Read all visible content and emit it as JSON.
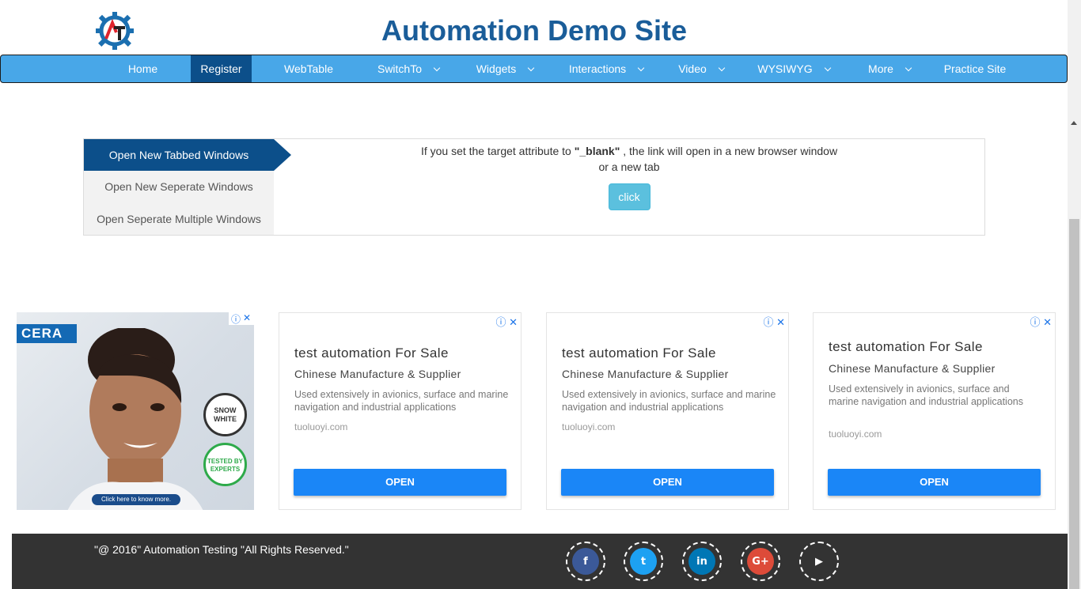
{
  "header": {
    "title": "Automation Demo Site"
  },
  "nav": {
    "items": [
      {
        "label": "Home"
      },
      {
        "label": "Register"
      },
      {
        "label": "WebTable"
      },
      {
        "label": "SwitchTo"
      },
      {
        "label": "Widgets"
      },
      {
        "label": "Interactions"
      },
      {
        "label": "Video"
      },
      {
        "label": "WYSIWYG"
      },
      {
        "label": "More"
      },
      {
        "label": "Practice Site"
      }
    ],
    "active": "Register"
  },
  "tabs": {
    "items": [
      {
        "label": "Open New Tabbed Windows"
      },
      {
        "label": "Open New Seperate Windows"
      },
      {
        "label": "Open Seperate Multiple Windows"
      }
    ],
    "content": {
      "text_before": "If you set the target attribute to ",
      "bold": "\"_blank\"",
      "text_after": " , the link will open in a new browser window",
      "line2": "or a new tab",
      "button": "click"
    }
  },
  "ad_image": {
    "brand": "CERA",
    "badge1": "SNOW WHITE",
    "badge2": "TESTED BY EXPERTS",
    "cta": "Click here to know more."
  },
  "ads": [
    {
      "title": "test automation For Sale",
      "subtitle": "Chinese Manufacture & Supplier",
      "body": "Used extensively in avionics, surface and marine navigation and industrial applications",
      "domain": "tuoluoyi.com",
      "button": "OPEN"
    },
    {
      "title": "test automation For Sale",
      "subtitle": "Chinese Manufacture & Supplier",
      "body": "Used extensively in avionics, surface and marine navigation and industrial applications",
      "domain": "tuoluoyi.com",
      "button": "OPEN"
    },
    {
      "title": "test automation For Sale",
      "subtitle": "Chinese Manufacture & Supplier",
      "body": "Used extensively in avionics, surface and marine navigation and industrial applications",
      "domain": "tuoluoyi.com",
      "button": "OPEN"
    }
  ],
  "footer": {
    "copyright": "\"@ 2016\" Automation Testing \"All Rights Reserved.\"",
    "social": [
      {
        "name": "facebook-icon",
        "color": "#3b5998",
        "glyph": "f"
      },
      {
        "name": "twitter-icon",
        "color": "#1da1f2",
        "glyph": "t"
      },
      {
        "name": "linkedin-icon",
        "color": "#0077b5",
        "glyph": "in"
      },
      {
        "name": "google-plus-icon",
        "color": "#dd4b39",
        "glyph": "G+"
      },
      {
        "name": "youtube-icon",
        "color": "#333333",
        "glyph": "▶"
      }
    ]
  },
  "colors": {
    "nav": "#48a7e8",
    "nav_active": "#0c4f8a",
    "title": "#1a5d99",
    "footer": "#333333",
    "ad_button": "#1a86f7"
  }
}
